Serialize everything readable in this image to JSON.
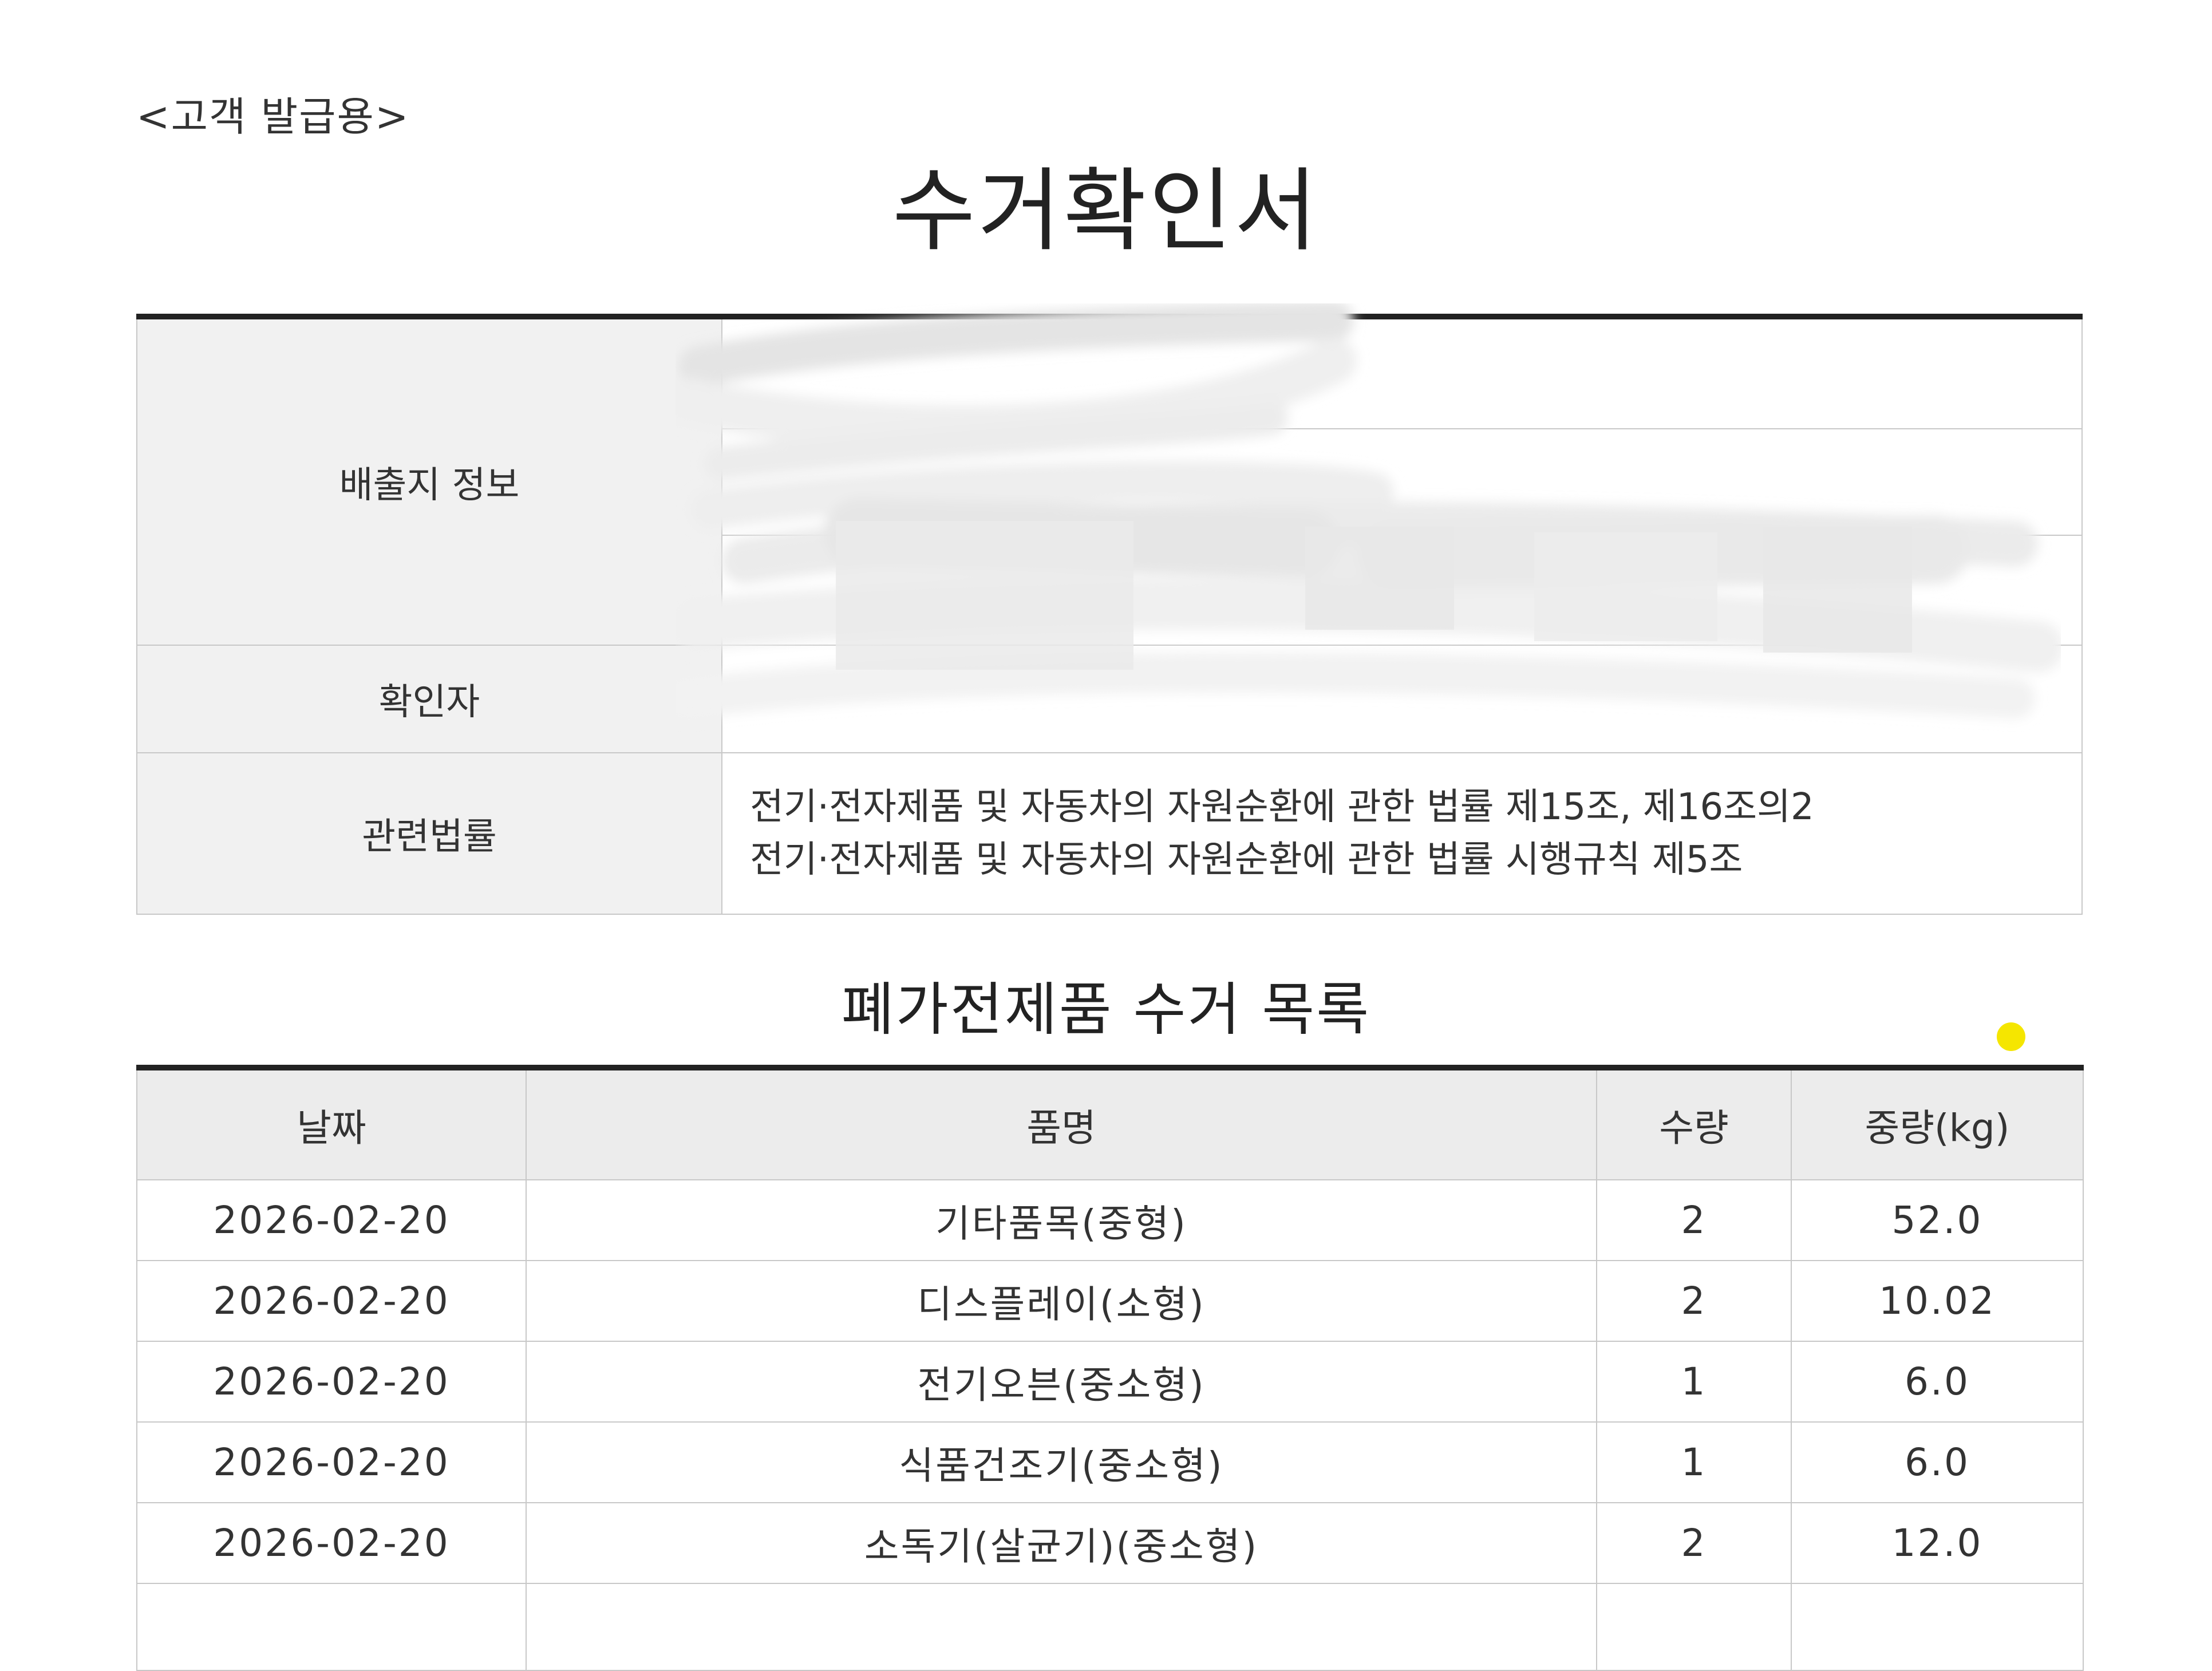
{
  "header": {
    "copy_label": "<고객 발급용>",
    "title": "수거확인서"
  },
  "info": {
    "discharge_label": "배출지 정보",
    "confirmer_label": "확인자",
    "law_label": "관련법률",
    "discharge_values": [
      "",
      "",
      ""
    ],
    "confirmer_value": "",
    "law_lines": [
      "전기·전자제품 및 자동차의 자원순환에 관한 법률 제15조, 제16조의2",
      "전기·전자제품 및 자동차의 자원순환에 관한 법률 시행규칙 제5조"
    ]
  },
  "list": {
    "title": "폐가전제품 수거 목록",
    "columns": [
      "날짜",
      "품명",
      "수량",
      "중량(kg)"
    ],
    "rows": [
      {
        "date": "2026-02-20",
        "name": "기타품목(중형)",
        "qty": "2",
        "weight": "52.0"
      },
      {
        "date": "2026-02-20",
        "name": "디스플레이(소형)",
        "qty": "2",
        "weight": "10.02"
      },
      {
        "date": "2026-02-20",
        "name": "전기오븐(중소형)",
        "qty": "1",
        "weight": "6.0"
      },
      {
        "date": "2026-02-20",
        "name": "식품건조기(중소형)",
        "qty": "1",
        "weight": "6.0"
      },
      {
        "date": "2026-02-20",
        "name": "소독기(살균기)(중소형)",
        "qty": "2",
        "weight": "12.0"
      }
    ]
  },
  "colors": {
    "label_bg": "#f1f1f1",
    "header_bg": "#ececec",
    "rule": "#222222",
    "border": "#c8c8c8",
    "marker": "#f5e600"
  }
}
